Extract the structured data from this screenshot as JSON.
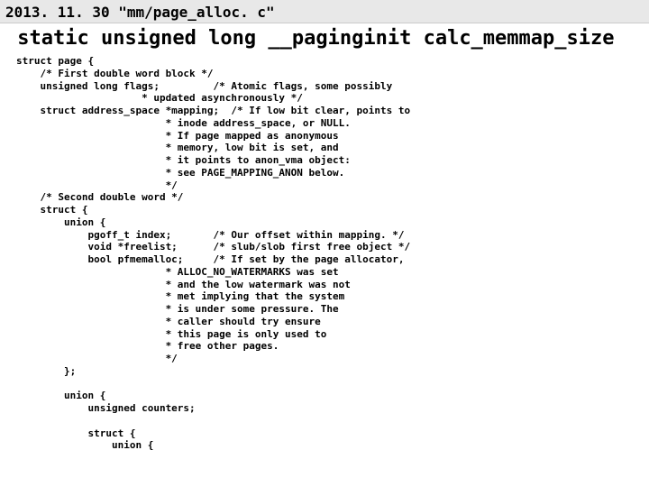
{
  "header": "2013. 11. 30 \"mm/page_alloc. c\"",
  "decl": " static unsigned long __paginginit calc_memmap_size",
  "code": "struct page {\n    /* First double word block */\n    unsigned long flags;         /* Atomic flags, some possibly\n                     * updated asynchronously */\n    struct address_space *mapping;  /* If low bit clear, points to\n                         * inode address_space, or NULL.\n                         * If page mapped as anonymous\n                         * memory, low bit is set, and\n                         * it points to anon_vma object:\n                         * see PAGE_MAPPING_ANON below.\n                         */\n    /* Second double word */\n    struct {\n        union {\n            pgoff_t index;       /* Our offset within mapping. */\n            void *freelist;      /* slub/slob first free object */\n            bool pfmemalloc;     /* If set by the page allocator,\n                         * ALLOC_NO_WATERMARKS was set\n                         * and the low watermark was not\n                         * met implying that the system\n                         * is under some pressure. The\n                         * caller should try ensure\n                         * this page is only used to\n                         * free other pages.\n                         */\n        };\n\n        union {\n            unsigned counters;\n\n            struct {\n                union {"
}
